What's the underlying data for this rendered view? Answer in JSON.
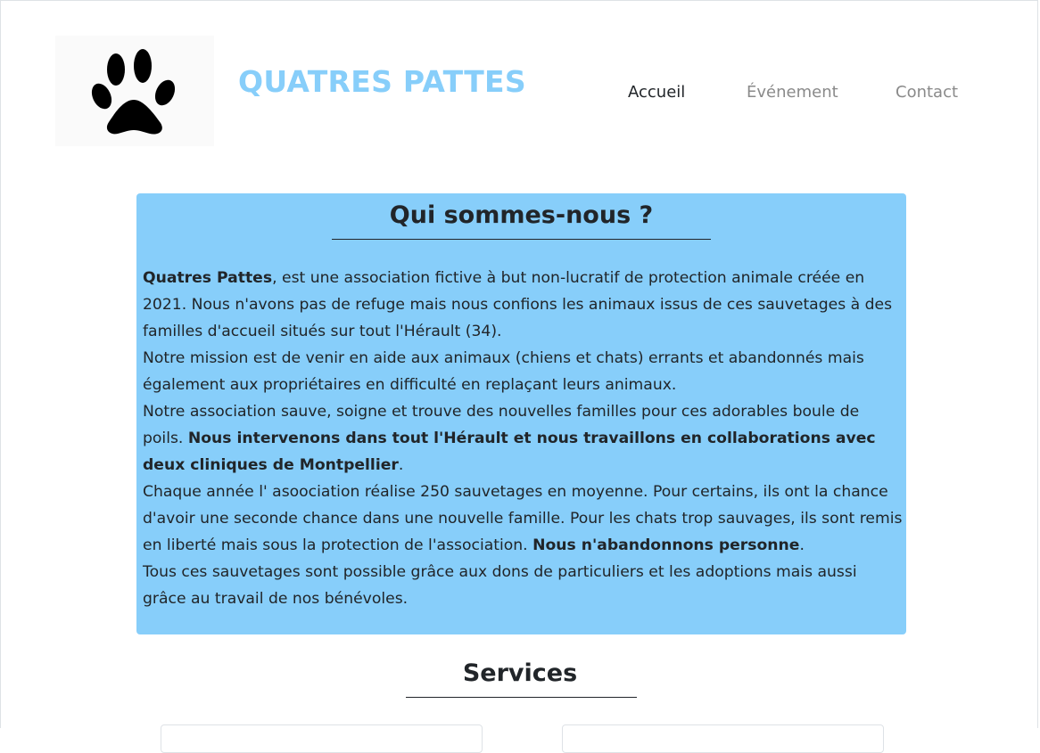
{
  "header": {
    "logo_icon": "paw-print-icon",
    "brand": "QUATRES PATTES",
    "brand_color": "#87cefa"
  },
  "nav": {
    "items": [
      {
        "label": "Accueil",
        "active": true
      },
      {
        "label": "Événement",
        "active": false
      },
      {
        "label": "Contact",
        "active": false
      }
    ]
  },
  "about": {
    "title": "Qui sommes-nous ?",
    "background": "#87cefa",
    "p1_bold": "Quatres Pattes",
    "p1_rest": ", est une association fictive à but non-lucratif de protection animale créée en 2021. Nous n'avons pas de refuge mais nous confions les animaux issus de ces sauvetages à des familles d'accueil situés sur tout l'Hérault (34).",
    "p2": "Notre mission est de venir en aide aux animaux (chiens et chats) errants et abandonnés mais également aux propriétaires en difficulté en replaçant leurs animaux.",
    "p3_start": "Notre association sauve, soigne et trouve des nouvelles familles pour ces adorables boule de poils. ",
    "p3_bold": "Nous intervenons dans tout l'Hérault et nous travaillons en collaborations avec deux cliniques de Montpellier",
    "p3_end": ".",
    "p4_start": "Chaque année l' asoociation réalise 250 sauvetages en moyenne. Pour certains, ils ont la chance d'avoir une seconde chance dans une nouvelle famille. Pour les chats trop sauvages, ils sont remis en liberté mais sous la protection de l'association. ",
    "p4_bold": "Nous n'abandonnons personne",
    "p4_end": ".",
    "p5": "Tous ces sauvetages sont possible grâce aux dons de particuliers et les adoptions mais aussi grâce au travail de nos bénévoles."
  },
  "services": {
    "title": "Services"
  }
}
